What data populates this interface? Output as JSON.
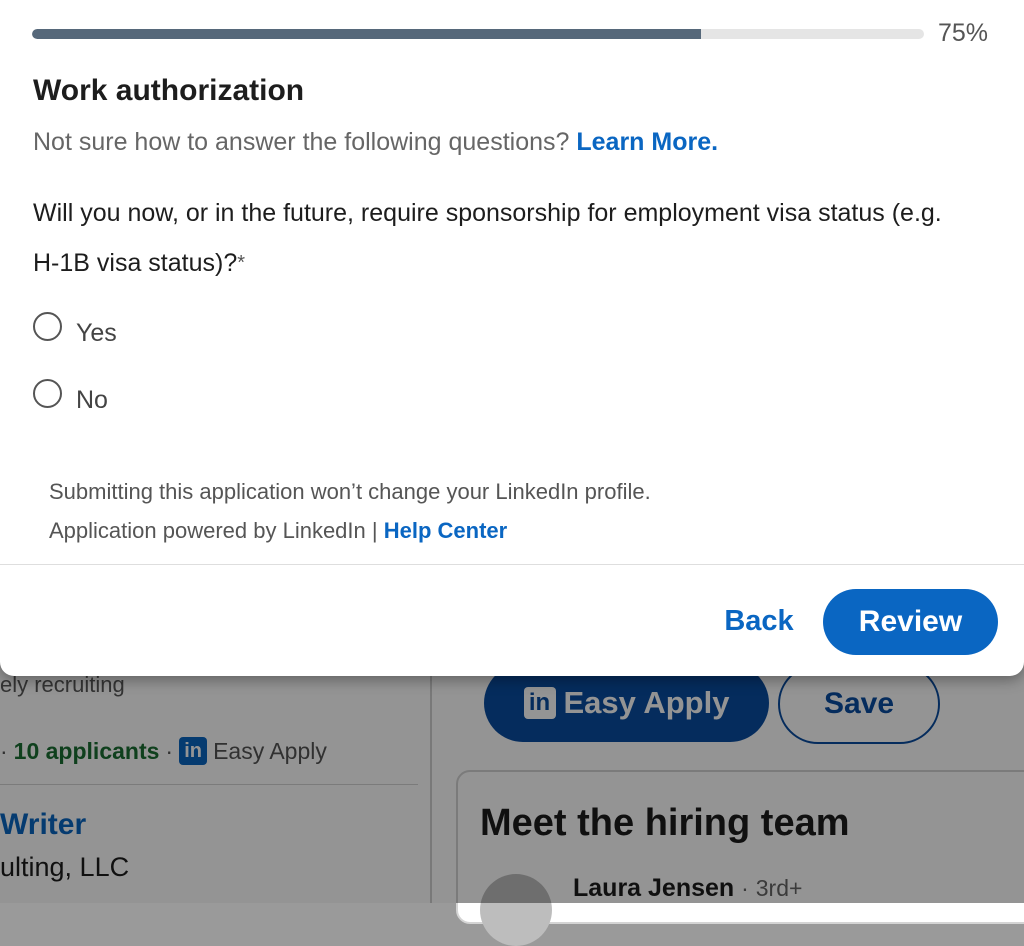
{
  "background": {
    "recruiting_text": "ely recruiting",
    "meta": {
      "separator_left": "·",
      "applicants": "10 applicants",
      "separator": "·",
      "easy_apply_icon": "linkedin-icon",
      "in_label": "in",
      "easy_apply_label": "Easy Apply"
    },
    "job_title": "Writer",
    "company": "ulting, LLC",
    "easy_apply_button": "Easy Apply",
    "save_button": "Save",
    "hiring_team_title": "Meet the hiring team",
    "person": {
      "name": "Laura Jensen",
      "separator": "·",
      "degree": "3rd+"
    }
  },
  "modal": {
    "progress": {
      "value_percent": 75,
      "label": "75%",
      "color": "#56687a"
    },
    "section_title": "Work authorization",
    "subtitle": "Not sure how to answer the following questions?",
    "learn_more_link": "Learn More.",
    "question": "Will you now, or in the future, require sponsorship for employment visa status (e.g. H-1B visa status)?",
    "required_marker": "*",
    "options": [
      {
        "label": "Yes",
        "selected": false
      },
      {
        "label": "No",
        "selected": false
      }
    ],
    "footer_line1": "Submitting this application won’t change your LinkedIn profile.",
    "footer_line2": "Application powered by LinkedIn |",
    "help_center_link": "Help Center",
    "back_button": "Back",
    "review_button": "Review",
    "accent_color": "#0a66c2"
  }
}
